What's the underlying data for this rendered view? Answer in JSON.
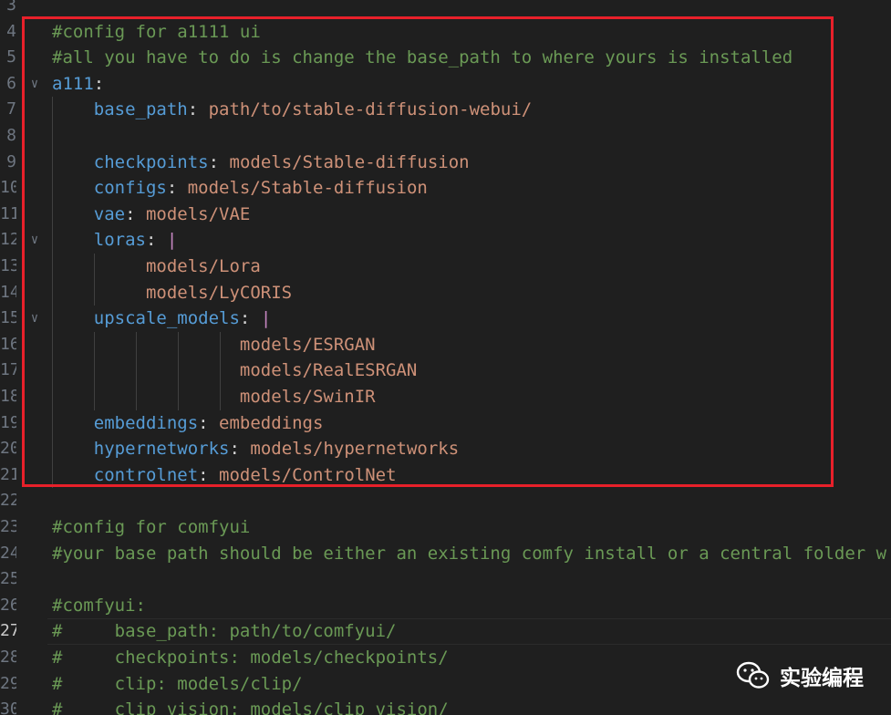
{
  "editor": {
    "language": "yaml",
    "active_line": "27",
    "lines": [
      {
        "num": "3",
        "tokens": []
      },
      {
        "num": "4",
        "tokens": [
          {
            "t": "#config for a1111 ui",
            "c": "comment"
          }
        ]
      },
      {
        "num": "5",
        "tokens": [
          {
            "t": "#all you have to do is change the base_path to where yours is installed",
            "c": "comment"
          }
        ]
      },
      {
        "num": "6",
        "fold": true,
        "tokens": [
          {
            "t": "a111",
            "c": "key"
          },
          {
            "t": ":",
            "c": "punc"
          }
        ]
      },
      {
        "num": "7",
        "tokens": [
          {
            "t": "    ",
            "c": "punc"
          },
          {
            "t": "base_path",
            "c": "key"
          },
          {
            "t": ": ",
            "c": "punc"
          },
          {
            "t": "path/to/stable-diffusion-webui/",
            "c": "str"
          }
        ]
      },
      {
        "num": "8",
        "tokens": []
      },
      {
        "num": "9",
        "tokens": [
          {
            "t": "    ",
            "c": "punc"
          },
          {
            "t": "checkpoints",
            "c": "key"
          },
          {
            "t": ": ",
            "c": "punc"
          },
          {
            "t": "models/Stable-diffusion",
            "c": "str"
          }
        ]
      },
      {
        "num": "10",
        "tokens": [
          {
            "t": "    ",
            "c": "punc"
          },
          {
            "t": "configs",
            "c": "key"
          },
          {
            "t": ": ",
            "c": "punc"
          },
          {
            "t": "models/Stable-diffusion",
            "c": "str"
          }
        ]
      },
      {
        "num": "11",
        "tokens": [
          {
            "t": "    ",
            "c": "punc"
          },
          {
            "t": "vae",
            "c": "key"
          },
          {
            "t": ": ",
            "c": "punc"
          },
          {
            "t": "models/VAE",
            "c": "str"
          }
        ]
      },
      {
        "num": "12",
        "fold": true,
        "tokens": [
          {
            "t": "    ",
            "c": "punc"
          },
          {
            "t": "loras",
            "c": "key"
          },
          {
            "t": ": ",
            "c": "punc"
          },
          {
            "t": "|",
            "c": "pipe"
          }
        ]
      },
      {
        "num": "13",
        "tokens": [
          {
            "t": "         ",
            "c": "punc"
          },
          {
            "t": "models/Lora",
            "c": "str"
          }
        ]
      },
      {
        "num": "14",
        "tokens": [
          {
            "t": "         ",
            "c": "punc"
          },
          {
            "t": "models/LyCORIS",
            "c": "str"
          }
        ]
      },
      {
        "num": "15",
        "fold": true,
        "tokens": [
          {
            "t": "    ",
            "c": "punc"
          },
          {
            "t": "upscale_models",
            "c": "key"
          },
          {
            "t": ": ",
            "c": "punc"
          },
          {
            "t": "|",
            "c": "pipe"
          }
        ]
      },
      {
        "num": "16",
        "tokens": [
          {
            "t": "                  ",
            "c": "punc"
          },
          {
            "t": "models/ESRGAN",
            "c": "str"
          }
        ]
      },
      {
        "num": "17",
        "tokens": [
          {
            "t": "                  ",
            "c": "punc"
          },
          {
            "t": "models/RealESRGAN",
            "c": "str"
          }
        ]
      },
      {
        "num": "18",
        "tokens": [
          {
            "t": "                  ",
            "c": "punc"
          },
          {
            "t": "models/SwinIR",
            "c": "str"
          }
        ]
      },
      {
        "num": "19",
        "tokens": [
          {
            "t": "    ",
            "c": "punc"
          },
          {
            "t": "embeddings",
            "c": "key"
          },
          {
            "t": ": ",
            "c": "punc"
          },
          {
            "t": "embeddings",
            "c": "str"
          }
        ]
      },
      {
        "num": "20",
        "tokens": [
          {
            "t": "    ",
            "c": "punc"
          },
          {
            "t": "hypernetworks",
            "c": "key"
          },
          {
            "t": ": ",
            "c": "punc"
          },
          {
            "t": "models/hypernetworks",
            "c": "str"
          }
        ]
      },
      {
        "num": "21",
        "tokens": [
          {
            "t": "    ",
            "c": "punc"
          },
          {
            "t": "controlnet",
            "c": "key"
          },
          {
            "t": ": ",
            "c": "punc"
          },
          {
            "t": "models/ControlNet",
            "c": "str"
          }
        ]
      },
      {
        "num": "22",
        "tokens": []
      },
      {
        "num": "23",
        "tokens": [
          {
            "t": "#config for comfyui",
            "c": "comment"
          }
        ]
      },
      {
        "num": "24",
        "tokens": [
          {
            "t": "#your base path should be either an existing comfy install or a central folder w",
            "c": "comment"
          }
        ]
      },
      {
        "num": "25",
        "tokens": []
      },
      {
        "num": "26",
        "tokens": [
          {
            "t": "#comfyui:",
            "c": "comment"
          }
        ]
      },
      {
        "num": "27",
        "tokens": [
          {
            "t": "#     base_path: path/to/comfyui/",
            "c": "comment"
          }
        ]
      },
      {
        "num": "28",
        "tokens": [
          {
            "t": "#     checkpoints: models/checkpoints/",
            "c": "comment"
          }
        ]
      },
      {
        "num": "29",
        "tokens": [
          {
            "t": "#     clip: models/clip/",
            "c": "comment"
          }
        ]
      },
      {
        "num": "30",
        "tokens": [
          {
            "t": "#     clip_vision: models/clip_vision/",
            "c": "comment"
          }
        ]
      }
    ]
  },
  "colors": {
    "background": "#1f1f1f",
    "comment": "#6a9955",
    "key": "#569cd6",
    "string": "#ce9178",
    "pipe": "#c586c0",
    "highlight_box": "#e8202a"
  },
  "watermark": {
    "icon": "wechat-icon",
    "text": "实验编程"
  }
}
